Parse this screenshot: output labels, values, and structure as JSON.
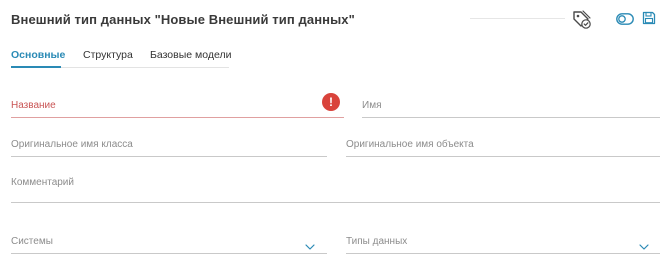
{
  "header": {
    "title": "Внешний тип данных \"Новые Внешний тип данных\"",
    "icons": [
      "tag-icon",
      "toggle-icon",
      "save-icon"
    ]
  },
  "tabs": [
    {
      "label": "Основные",
      "active": true
    },
    {
      "label": "Структура",
      "active": false
    },
    {
      "label": "Базовые модели",
      "active": false
    }
  ],
  "form": {
    "name_label": "Название",
    "name_value": "",
    "name_error": true,
    "alias_label": "Имя",
    "class_name_label": "Оригинальное имя класса",
    "object_name_label": "Оригинальное имя объекта",
    "comment_label": "Комментарий",
    "systems_label": "Системы",
    "data_types_label": "Типы данных"
  },
  "colors": {
    "accent": "#2a8ab5",
    "error": "#d9433b",
    "error_label": "#c95454"
  }
}
